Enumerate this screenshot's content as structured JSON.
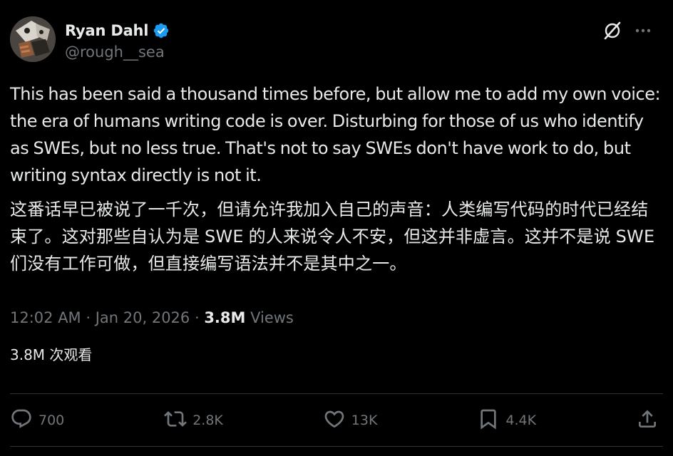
{
  "author": {
    "display_name": "Ryan Dahl",
    "handle": "@rough__sea",
    "verified": true
  },
  "tweet": {
    "text_en": "This has been said a thousand times before, but allow me to add my own voice: the era of humans writing code is over. Disturbing for those of us who identify as SWEs, but no less true. That's not to say SWEs don't have work to do, but writing syntax directly is not it.",
    "text_zh": "这番话早已被说了一千次，但请允许我加入自己的声音：人类编写代码的时代已经结束了。这对那些自认为是 SWE 的人来说令人不安，但这并非虚言。这并不是说 SWE 们没有工作可做，但直接编写语法并不是其中之一。",
    "time": "12:02 AM",
    "sep1": " · ",
    "date": "Jan 20, 2026",
    "sep2": " · ",
    "views_count": "3.8M",
    "views_label": " Views",
    "translated_views": "3.8M 次观看"
  },
  "actions": {
    "replies": "700",
    "reposts": "2.8K",
    "likes": "13K",
    "bookmarks": "4.4K"
  },
  "icons": {
    "verified": "verified-badge-icon",
    "grok": "grok-icon",
    "more": "more-dots-icon",
    "reply": "reply-icon",
    "repost": "repost-icon",
    "like": "heart-icon",
    "bookmark": "bookmark-icon",
    "share": "share-icon"
  },
  "colors": {
    "background": "#000000",
    "text_primary": "#e7e9ea",
    "text_secondary": "#71767b",
    "verified_blue": "#1d9bf0",
    "divider": "#2f3336"
  }
}
